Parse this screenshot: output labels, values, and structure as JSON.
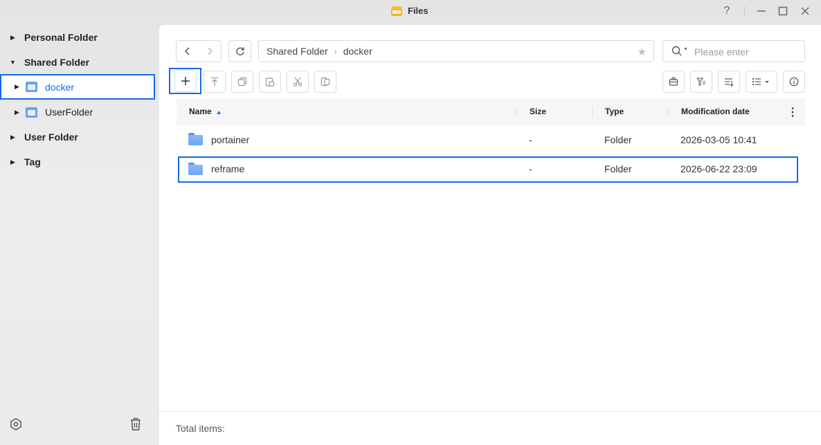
{
  "window": {
    "title": "Files",
    "controls": {
      "help": "?",
      "minimize": "—",
      "maximize": "☐",
      "close": "✕"
    }
  },
  "sidebar": {
    "items": [
      {
        "label": "Personal Folder",
        "level": 0,
        "expanded": false
      },
      {
        "label": "Shared Folder",
        "level": 0,
        "expanded": true
      },
      {
        "label": "docker",
        "level": 1,
        "expanded": false,
        "selected": true
      },
      {
        "label": "UserFolder",
        "level": 1,
        "expanded": false
      },
      {
        "label": "User Folder",
        "level": 0,
        "expanded": false
      },
      {
        "label": "Tag",
        "level": 0,
        "expanded": false
      }
    ],
    "bottom": {
      "settings_icon": "hexagon-settings-icon",
      "trash_icon": "trash-icon"
    }
  },
  "toolbar": {
    "back_icon": "chevron-left-icon",
    "forward_icon": "chevron-right-icon",
    "refresh_icon": "refresh-icon",
    "breadcrumb": [
      "Shared Folder",
      "docker"
    ],
    "favorite_icon": "star-icon",
    "search_placeholder": "Please enter",
    "actions_left": [
      "new",
      "upload",
      "copy",
      "paste",
      "cut",
      "move"
    ],
    "actions_right": [
      "toolbox",
      "filter",
      "sort",
      "view-mode",
      "info"
    ]
  },
  "table": {
    "columns": {
      "name": "Name",
      "size": "Size",
      "type": "Type",
      "modified": "Modification date"
    },
    "rows": [
      {
        "name": "portainer",
        "size": "-",
        "type": "Folder",
        "modified": "2026-03-05 10:41",
        "selected": false
      },
      {
        "name": "reframe",
        "size": "-",
        "type": "Folder",
        "modified": "2026-06-22 23:09",
        "selected": true
      }
    ]
  },
  "footer": {
    "total_label": "Total items:"
  },
  "colors": {
    "accent": "#1769e7",
    "folder": "#6ea5f4",
    "panel": "#ffffff"
  }
}
